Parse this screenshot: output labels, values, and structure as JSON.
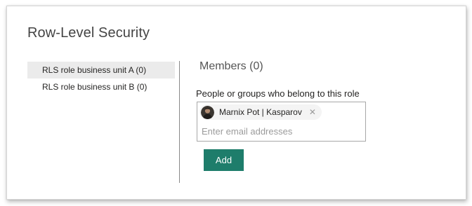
{
  "dialog": {
    "title": "Row-Level Security"
  },
  "roles": {
    "items": [
      {
        "label": "RLS role business unit A (0)",
        "selected": true
      },
      {
        "label": "RLS role business unit B (0)",
        "selected": false
      }
    ]
  },
  "members": {
    "heading": "Members (0)",
    "field_label": "People or groups who belong to this role",
    "chips": [
      {
        "name": "Marnix Pot | Kasparov",
        "remove_icon": "close-icon"
      }
    ],
    "input": {
      "value": "",
      "placeholder": "Enter email addresses"
    },
    "add_label": "Add"
  },
  "colors": {
    "accent": "#1e7d6b",
    "selected_row": "#ebebeb",
    "chip_bg": "#f4f4f4"
  }
}
